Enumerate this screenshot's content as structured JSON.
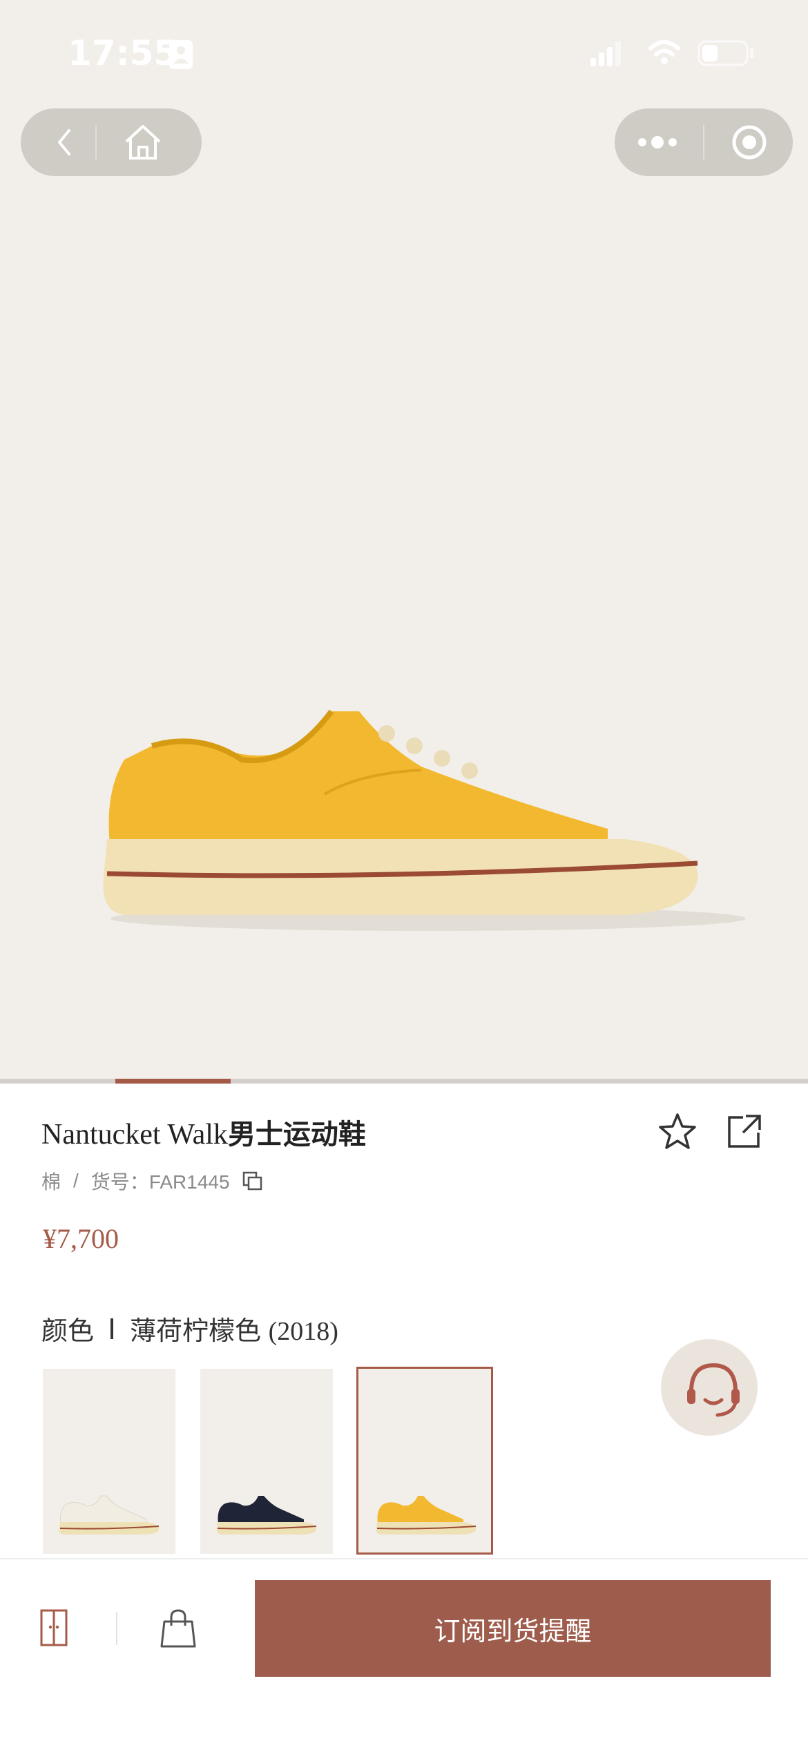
{
  "status_bar": {
    "time": "17:55"
  },
  "product": {
    "title_en": "Nantucket Walk",
    "title_cn": "男士运动鞋",
    "material": "棉",
    "sku_label": "货号：",
    "sku": "FAR1445",
    "price": "¥7,700"
  },
  "color": {
    "label": "颜色",
    "selected_name": "薄荷柠檬色",
    "selected_code": "(2018)",
    "swatches": [
      {
        "name": "white-shoe",
        "color": "#f1ede3"
      },
      {
        "name": "navy-shoe",
        "color": "#1f2436"
      },
      {
        "name": "yellow-shoe",
        "color": "#f2b830"
      }
    ]
  },
  "gallery": {
    "current": 2,
    "total": 7
  },
  "bottom_bar": {
    "subscribe_label": "订阅到货提醒"
  },
  "colors": {
    "accent": "#a55a48",
    "background": "#f2efea"
  }
}
